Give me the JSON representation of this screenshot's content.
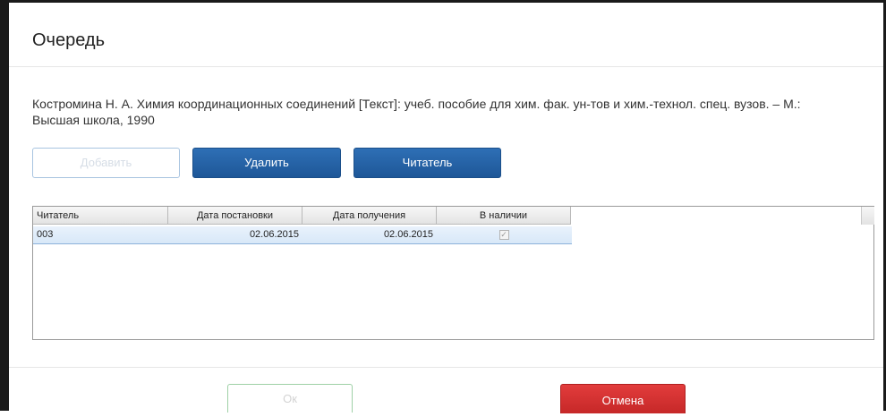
{
  "dialog": {
    "title": "Очередь",
    "description": "Костромина Н. А. Химия координационных соединений [Текст]: учеб. пособие для хим. фак. ун-тов и хим.-технол. спец. вузов. – М.: Высшая школа, 1990"
  },
  "toolbar": {
    "add_label": "Добавить",
    "delete_label": "Удалить",
    "reader_label": "Читатель"
  },
  "table": {
    "headers": {
      "reader": "Читатель",
      "date_queued": "Дата постановки",
      "date_received": "Дата получения",
      "available": "В наличии"
    },
    "rows": [
      {
        "reader": "003",
        "date_queued": "02.06.2015",
        "date_received": "02.06.2015",
        "available": true
      }
    ]
  },
  "footer": {
    "ok_label": "Ок",
    "cancel_label": "Отмена"
  },
  "colors": {
    "primary": "#1e5798",
    "danger": "#c62828",
    "selected_row": "#d8e8f8"
  }
}
